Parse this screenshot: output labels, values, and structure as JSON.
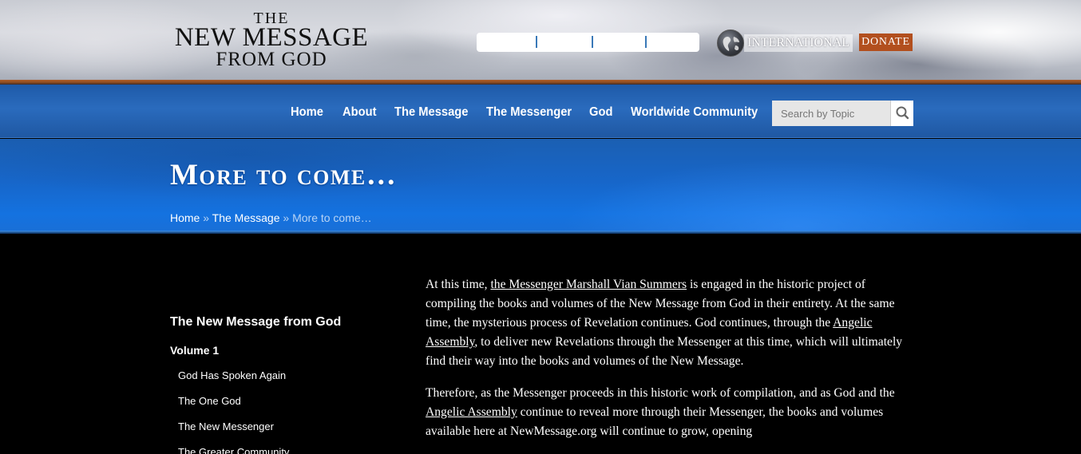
{
  "logo": {
    "line1": "THE",
    "line2": "NEW MESSAGE",
    "line3": "FROM GOD"
  },
  "header": {
    "international_label": "INTERNATIONAL",
    "donate_label": "DONATE",
    "globe_icon": "globe-icon"
  },
  "colors": {
    "nav_blue": "#1e5aa8",
    "donate_orange": "#b24f1e",
    "header_rule": "#b0602a",
    "breadcrumb_current": "#b8d4f5"
  },
  "nav": {
    "items": [
      "Home",
      "About",
      "The Message",
      "The Messenger",
      "God",
      "Worldwide Community"
    ],
    "search_placeholder": "Search by Topic",
    "search_icon": "search-icon"
  },
  "hero": {
    "title": "More to come…",
    "breadcrumb": {
      "home": "Home",
      "sep1": " » ",
      "message": "The Message",
      "sep2": " » ",
      "current": "More to come…"
    }
  },
  "sidebar": {
    "heading": "The New Message from God",
    "volume": "Volume 1",
    "items": [
      "God Has Spoken Again",
      "The One God",
      "The New Messenger",
      "The Greater Community"
    ]
  },
  "content": {
    "p1_a": "At this time, ",
    "p1_link1": "the Messenger Marshall Vian Summers",
    "p1_b": " is engaged in the historic project of compiling the books and volumes of the New Message from God in their entirety. At the same time, the mysterious process of Revelation continues. God continues, through the ",
    "p1_link2": "Angelic Assembly",
    "p1_c": ", to deliver new Revelations through the Messenger at this time, which will ultimately find their way into the books and volumes of the New Message.",
    "p2_a": "Therefore, as the Messenger proceeds in this historic work of compilation, and as God and the ",
    "p2_link1": "Angelic Assembly",
    "p2_b": " continue to reveal more through their Messenger, the books and volumes available here at NewMessage.org will continue to grow, opening"
  }
}
